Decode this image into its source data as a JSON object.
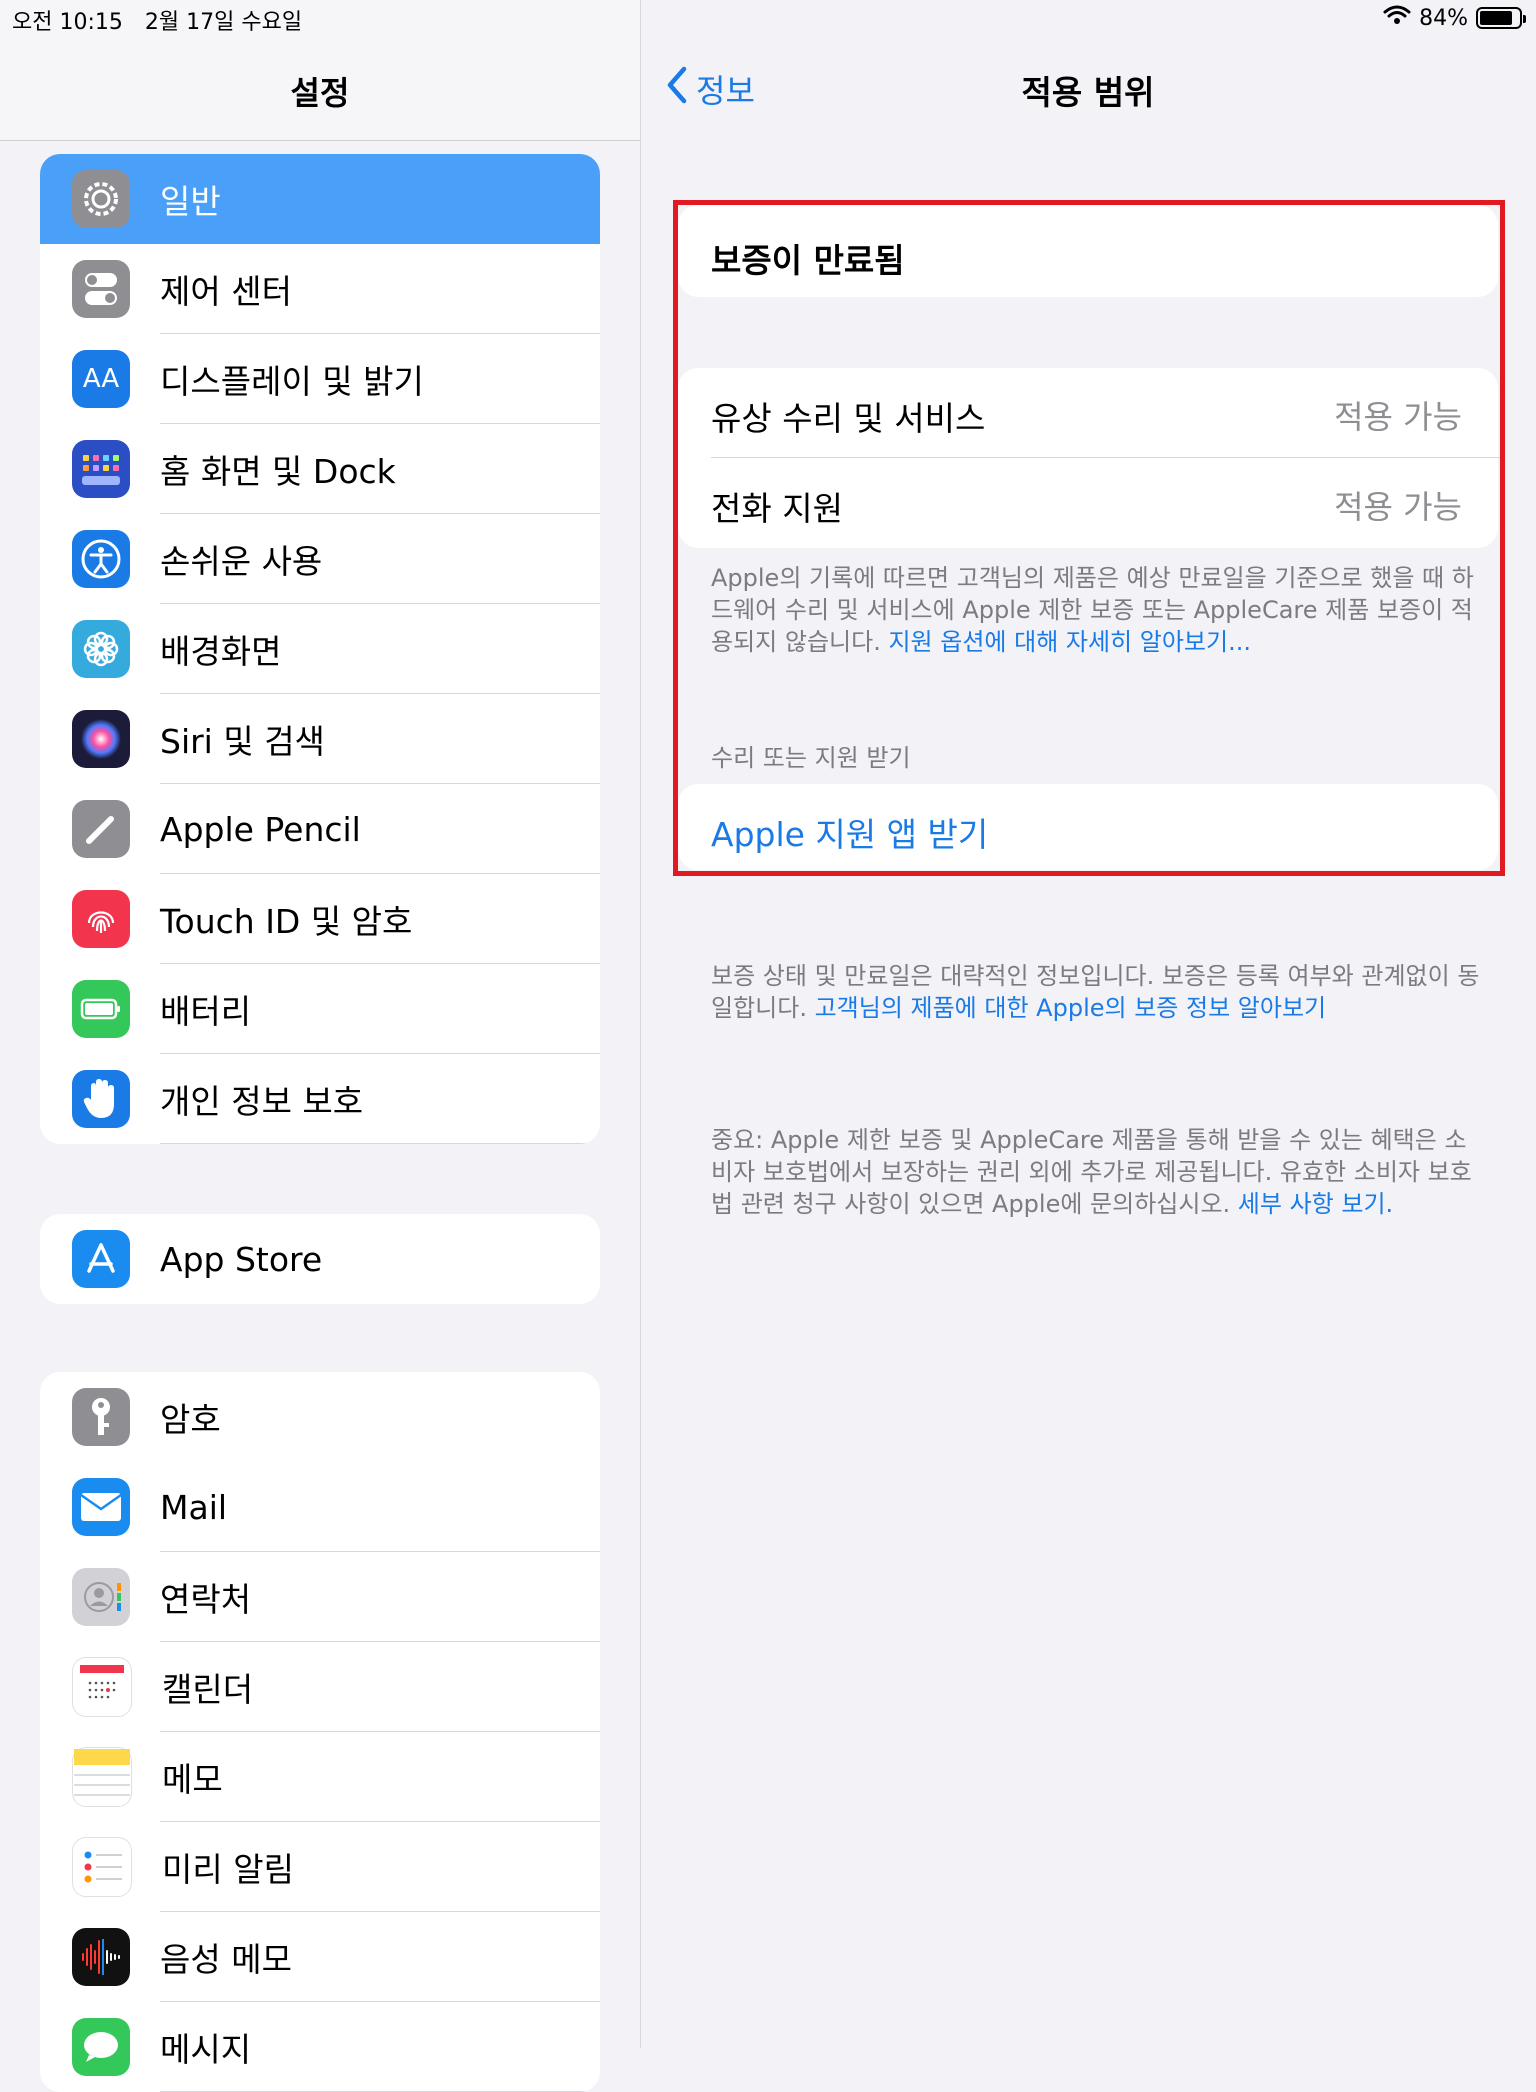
{
  "status_bar": {
    "time": "오전 10:15",
    "date": "2월 17일 수요일",
    "battery": "84%",
    "battery_level": 0.84
  },
  "sidebar": {
    "title": "설정",
    "group1": [
      {
        "label": "일반",
        "icon": "gear-icon",
        "color": "#8e8e93",
        "selected": true
      },
      {
        "label": "제어 센터",
        "icon": "toggles-icon",
        "color": "#8e8e93"
      },
      {
        "label": "디스플레이 및 밝기",
        "icon": "text-size-icon",
        "color": "#1a7be6"
      },
      {
        "label": "홈 화면 및 Dock",
        "icon": "home-grid-icon",
        "color": "#2b4ec5"
      },
      {
        "label": "손쉬운 사용",
        "icon": "accessibility-icon",
        "color": "#1a7be6"
      },
      {
        "label": "배경화면",
        "icon": "flower-icon",
        "color": "#35aadc"
      },
      {
        "label": "Siri 및 검색",
        "icon": "siri-icon",
        "color": "#1c1c3a"
      },
      {
        "label": "Apple Pencil",
        "icon": "pencil-icon",
        "color": "#8e8e93"
      },
      {
        "label": "Touch ID 및 암호",
        "icon": "fingerprint-icon",
        "color": "#f2354d"
      },
      {
        "label": "배터리",
        "icon": "battery-icon",
        "color": "#34c759"
      },
      {
        "label": "개인 정보 보호",
        "icon": "hand-icon",
        "color": "#1a7be6"
      }
    ],
    "group2": [
      {
        "label": "App Store",
        "icon": "app-store-icon",
        "color": "#1a8cf0"
      }
    ],
    "group3": [
      {
        "label": "암호",
        "icon": "key-icon",
        "color": "#8e8e93"
      },
      {
        "label": "Mail",
        "icon": "mail-icon",
        "color": "#1a8cf0"
      },
      {
        "label": "연락처",
        "icon": "contacts-icon",
        "color": "#c8c8cc"
      },
      {
        "label": "캘린더",
        "icon": "calendar-icon",
        "color": "#ffffff"
      },
      {
        "label": "메모",
        "icon": "notes-icon",
        "color": "#fff1a8"
      },
      {
        "label": "미리 알림",
        "icon": "reminders-icon",
        "color": "#ffffff"
      },
      {
        "label": "음성 메모",
        "icon": "voice-memo-icon",
        "color": "#111111"
      },
      {
        "label": "메시지",
        "icon": "messages-icon",
        "color": "#34c759"
      }
    ]
  },
  "detail": {
    "back_label": "정보",
    "title": "적용 범위",
    "warranty_status": "보증이 만료됨",
    "rows": [
      {
        "label": "유상 수리 및 서비스",
        "value": "적용 가능"
      },
      {
        "label": "전화 지원",
        "value": "적용 가능"
      }
    ],
    "note1_text": "Apple의 기록에 따르면 고객님의 제품은 예상 만료일을 기준으로 했을 때 하드웨어 수리 및 서비스에 Apple 제한 보증 또는 AppleCare 제품 보증이 적용되지 않습니다. ",
    "note1_link": "지원 옵션에 대해 자세히 알아보기...",
    "section_label": "수리 또는 지원 받기",
    "support_link": "Apple 지원 앱 받기",
    "note2_text": "보증 상태 및 만료일은 대략적인 정보입니다. 보증은 등록 여부와 관계없이 동일합니다. ",
    "note2_link": "고객님의 제품에 대한 Apple의 보증 정보 알아보기",
    "note3_text": "중요: Apple 제한 보증 및 AppleCare 제품을 통해 받을 수 있는 혜택은 소비자 보호법에서 보장하는 권리 외에 추가로 제공됩니다. 유효한 소비자 보호법 관련 청구 사항이 있으면 Apple에 문의하십시오. ",
    "note3_link": "세부 사항 보기."
  },
  "colors": {
    "accent": "#1a7be6",
    "selected": "#4aa0f8",
    "highlight_border": "#e11a22"
  }
}
